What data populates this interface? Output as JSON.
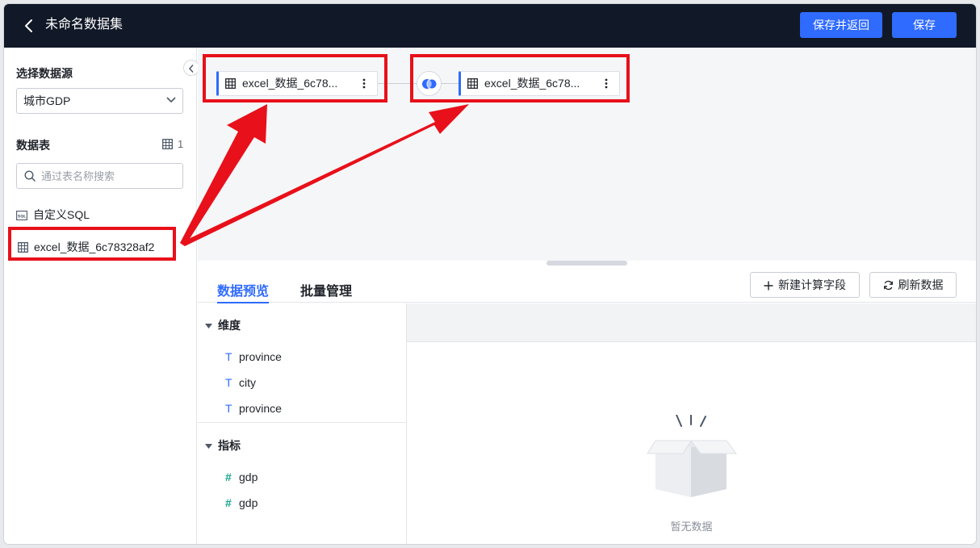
{
  "header": {
    "title": "未命名数据集",
    "save_and_return": "保存并返回",
    "save": "保存"
  },
  "sidebar": {
    "source_label": "选择数据源",
    "source_value": "城市GDP",
    "tables_label": "数据表",
    "table_count": "1",
    "search_placeholder": "通过表名称搜索",
    "items": [
      {
        "label": "自定义SQL",
        "icon": "sql-icon"
      },
      {
        "label": "excel_数据_6c78328af2",
        "icon": "table-icon"
      }
    ]
  },
  "canvas": {
    "nodes": [
      {
        "label": "excel_数据_6c78...",
        "icon": "table-icon"
      },
      {
        "label": "excel_数据_6c78...",
        "icon": "table-icon"
      }
    ],
    "join_icon": "join-icon"
  },
  "tabs": {
    "preview": "数据预览",
    "batch": "批量管理",
    "new_field": "新建计算字段",
    "refresh": "刷新数据"
  },
  "fields": {
    "dimensions_label": "维度",
    "dimensions": [
      "province",
      "city",
      "province"
    ],
    "dimension_type_glyph": "T",
    "measures_label": "指标",
    "measures": [
      "gdp",
      "gdp"
    ],
    "measure_type_glyph": "#"
  },
  "preview": {
    "empty_text": "暂无数据"
  },
  "colors": {
    "topbar": "#111827",
    "accent": "#2f6bff",
    "annotation": "#e8101a"
  }
}
